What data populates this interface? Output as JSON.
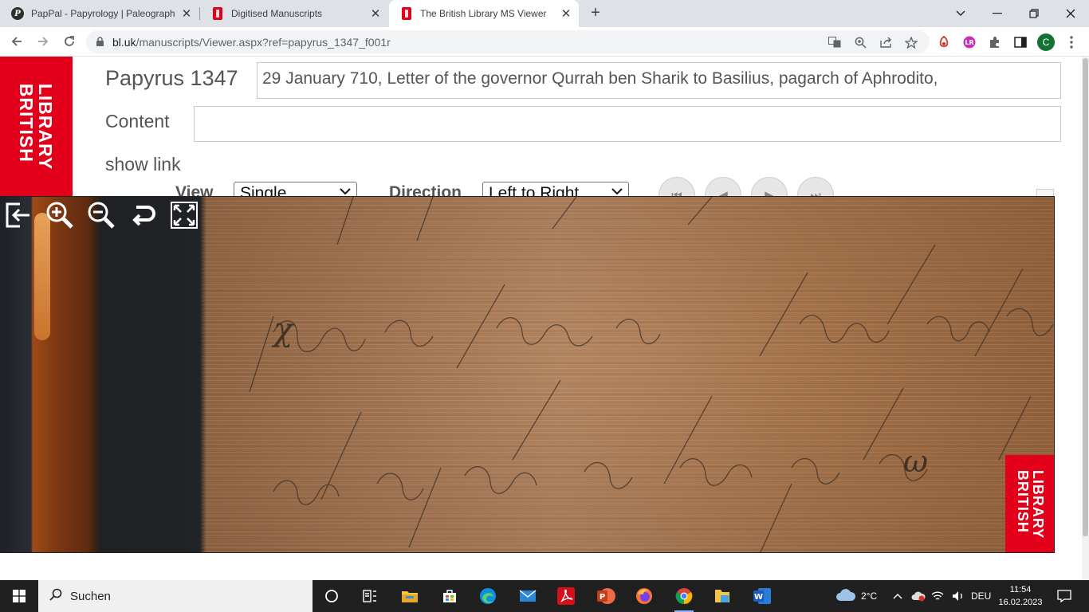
{
  "browser": {
    "tabs": [
      {
        "title": "PapPal - Papyrology | Paleograph",
        "favicon": "pappal-icon",
        "active": false
      },
      {
        "title": "Digitised Manuscripts",
        "favicon": "british-library-icon",
        "active": false
      },
      {
        "title": "The British Library MS Viewer",
        "favicon": "british-library-icon",
        "active": true
      }
    ],
    "new_tab_label": "+",
    "url_host": "bl.uk",
    "url_path": "/manuscripts/Viewer.aspx?ref=papyrus_1347_f001r",
    "profile_initial": "C",
    "window_controls": [
      "chevron-down-icon",
      "minimize-icon",
      "restore-icon",
      "close-icon"
    ]
  },
  "logo": {
    "text_line1": "LIBRARY",
    "text_line2": "BRITISH",
    "color": "#e3001b"
  },
  "manuscript": {
    "title": "Papyrus 1347",
    "description": "29 January 710, Letter of the governor Qurrah ben Sharik to Basilius, pagarch of Aphrodito,",
    "content_label": "Content",
    "content_value": "",
    "show_link_label": "show link"
  },
  "viewer_controls": {
    "view_label": "View",
    "view_value": "Single",
    "direction_label": "Direction",
    "direction_value": "Left to Right",
    "pager_buttons": [
      "first-page-icon",
      "previous-page-icon",
      "next-page-icon",
      "last-page-icon"
    ]
  },
  "viewer": {
    "tools": [
      "exit-viewer-icon",
      "zoom-in-icon",
      "zoom-out-icon",
      "rotate-icon",
      "fullscreen-icon"
    ],
    "stamp_line1": "LIBRARY",
    "stamp_line2": "BRITISH"
  },
  "taskbar": {
    "search_placeholder": "Suchen",
    "weather": "2°C",
    "language": "DEU",
    "time": "11:54",
    "date": "16.02.2023",
    "apps": [
      "task-view-icon",
      "widgets-icon",
      "file-explorer-icon",
      "store-icon",
      "edge-icon",
      "mail-icon",
      "acrobat-icon",
      "powerpoint-icon",
      "firefox-icon",
      "chrome-icon",
      "folder-icon",
      "word-icon"
    ]
  }
}
